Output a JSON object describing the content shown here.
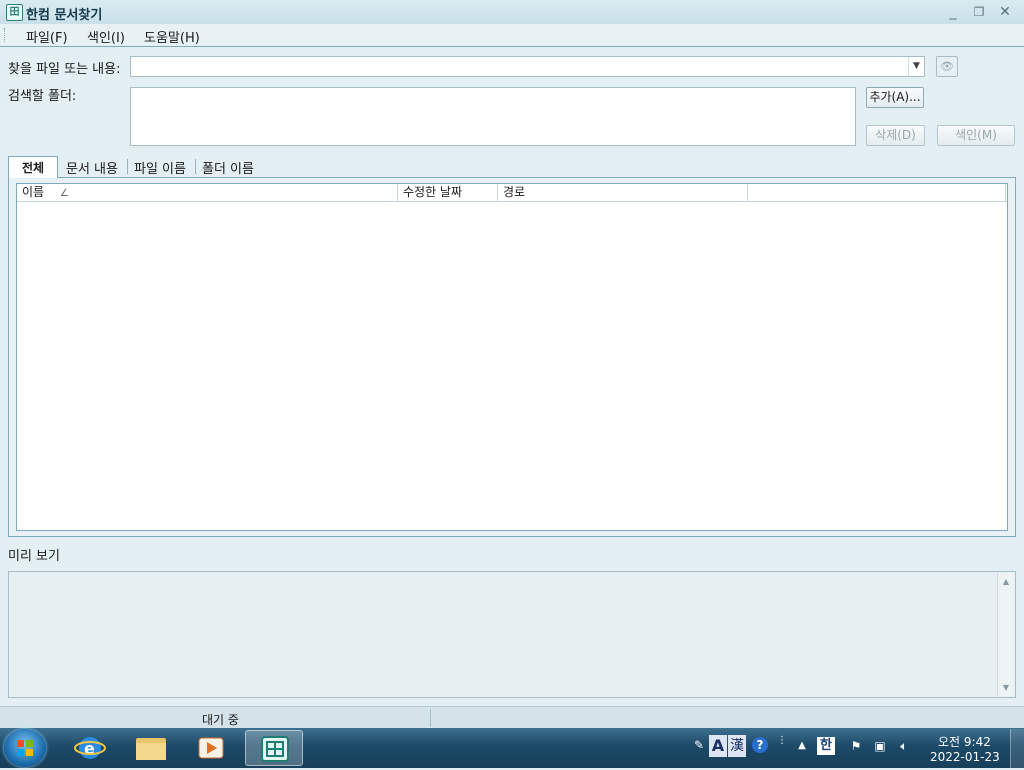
{
  "window": {
    "title": "한컴 문서찾기",
    "icon_glyph": "田"
  },
  "menu": {
    "items": [
      "파일(F)",
      "색인(I)",
      "도움말(H)"
    ]
  },
  "form": {
    "search_label": "찾을 파일 또는 내용:",
    "search_value": "",
    "folder_label": "검색할 폴더:",
    "add_button": "추가(A)...",
    "delete_button": "삭제(D)",
    "index_button": "색인(M)"
  },
  "tabs": [
    "전체",
    "문서 내용",
    "파일 이름",
    "폴더 이름"
  ],
  "results": {
    "columns": [
      "이름",
      "수정한 날짜",
      "경로",
      ""
    ],
    "sort_glyph": "∠",
    "rows": []
  },
  "preview": {
    "label": "미리 보기"
  },
  "status": {
    "text": "대기 중"
  },
  "taskbar": {
    "time": "오전 9:42",
    "date": "2022-01-23",
    "apps": [
      "internet-explorer-icon",
      "file-explorer-icon",
      "media-player-icon",
      "hancom-finder-icon"
    ]
  },
  "colors": {
    "accent": "#7eaab9",
    "background": "#e3eff3",
    "taskbar": "#1c4a68"
  }
}
